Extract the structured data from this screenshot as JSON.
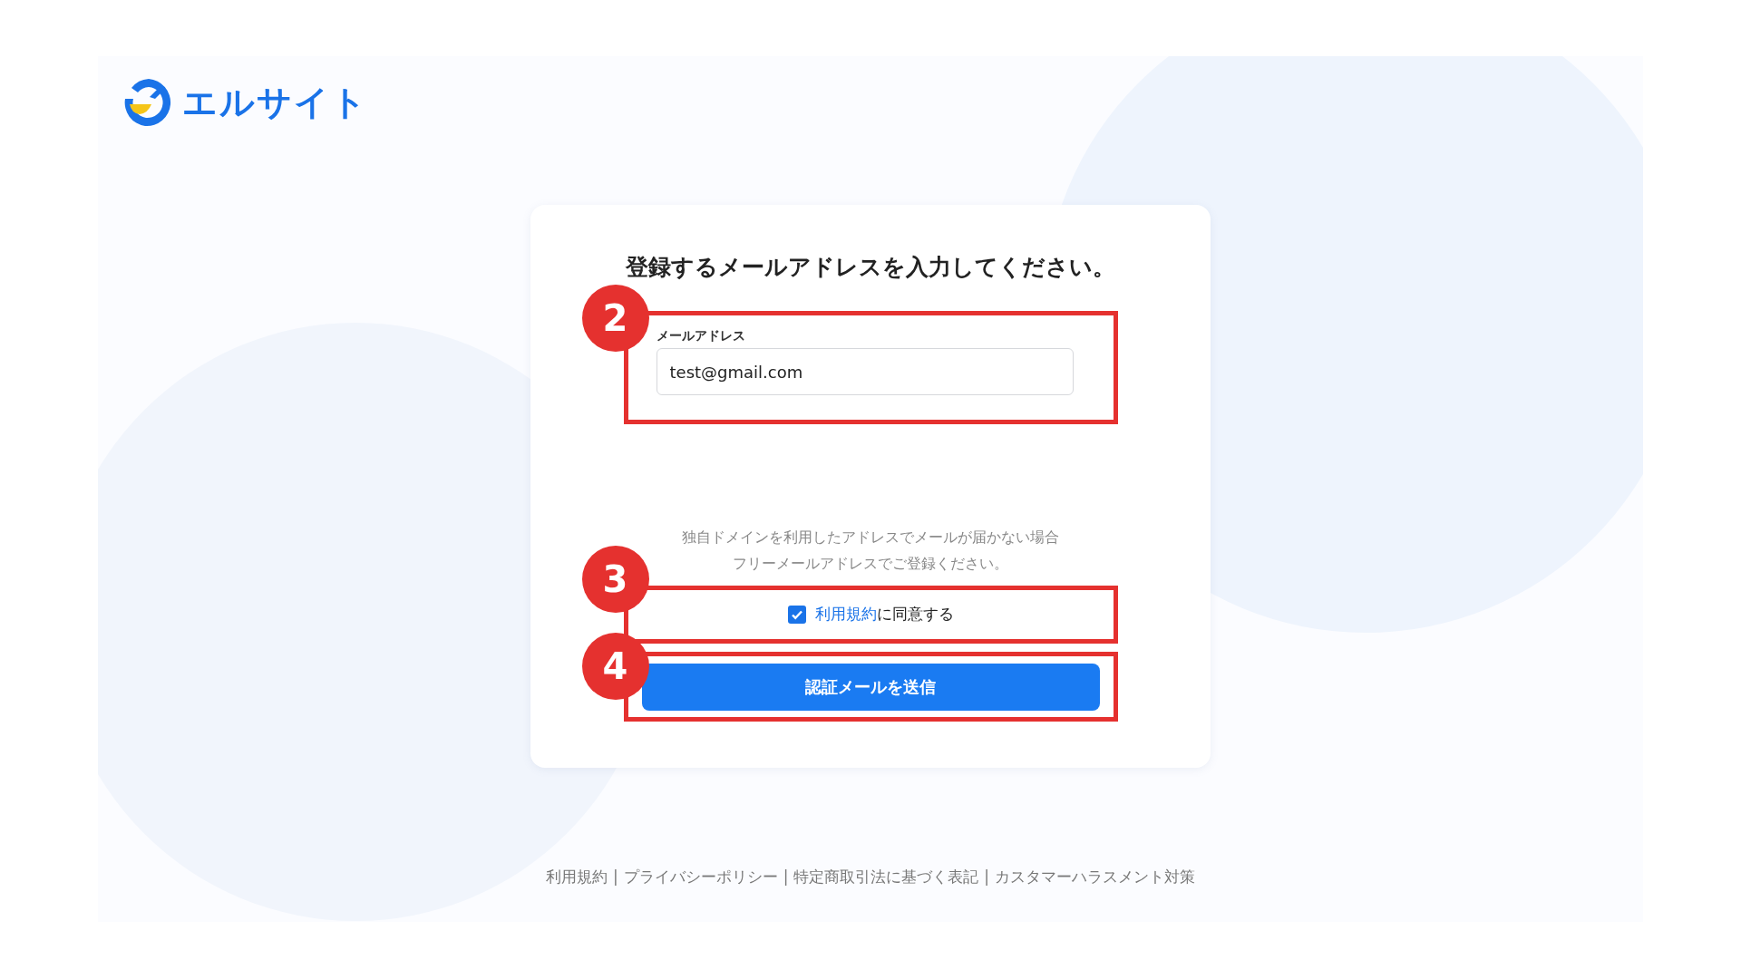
{
  "logo": {
    "text": "エルサイト"
  },
  "card": {
    "title": "登録するメールアドレスを入力してください。",
    "email_field": {
      "label": "メールアドレス",
      "value": "test@gmail.com"
    },
    "hint": [
      "独自ドメインを利用したアドレスでメールが届かない場合",
      "フリーメールアドレスでご登録ください。"
    ],
    "agreement": {
      "checked": true,
      "link": "利用規約",
      "text": "に同意する"
    },
    "submit_button": {
      "label": "認証メールを送信"
    }
  },
  "annotations": [
    {
      "number": "2"
    },
    {
      "number": "3"
    },
    {
      "number": "4"
    }
  ],
  "footer": {
    "separator": "|",
    "links": [
      "利用規約",
      "プライバシーポリシー",
      "特定商取引法に基づく表記",
      "カスタマーハラスメント対策"
    ]
  }
}
